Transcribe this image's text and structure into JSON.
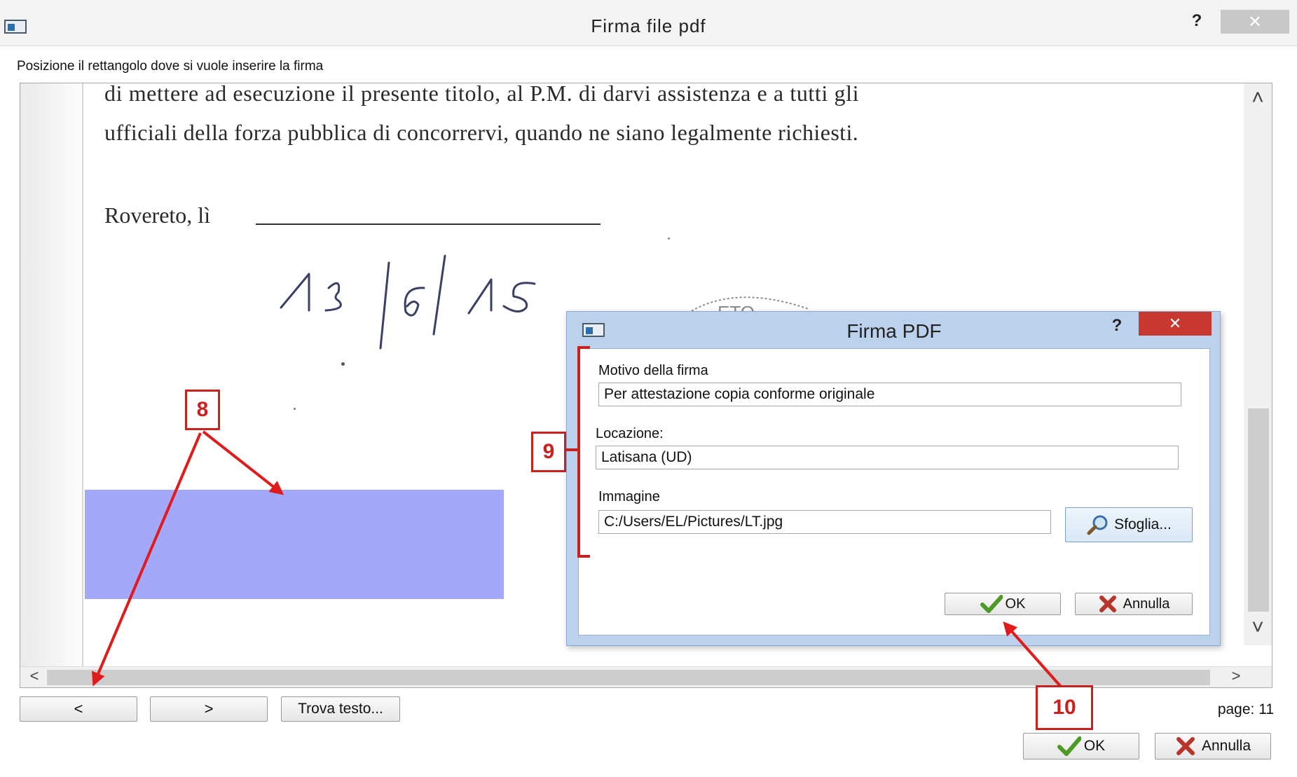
{
  "main_window": {
    "title": "Firma file pdf",
    "help_label": "?",
    "close_label": "✕",
    "instruction": "Posizione il rettangolo dove si vuole inserire la firma"
  },
  "document": {
    "line1": "di mettere ad esecuzione il presente titolo, al P.M. di darvi assistenza e a tutti gli",
    "line2": "ufficiali della forza pubblica di concorrervi, quando ne siano legalmente richiesti.",
    "place_label": "Rovereto, lì",
    "handwritten_date": "13/6/15",
    "stamp_fragment": "ETO"
  },
  "scroll": {
    "up": "˄",
    "down": "˅",
    "left": "<",
    "right": ">"
  },
  "nav": {
    "prev_label": "<",
    "next_label": ">",
    "find_label": "Trova testo...",
    "page_label": "page: 11"
  },
  "footer": {
    "ok_label": "OK",
    "cancel_label": "Annulla"
  },
  "dialog": {
    "title": "Firma PDF",
    "help_label": "?",
    "close_label": "✕",
    "reason_label": "Motivo della firma",
    "reason_value": "Per attestazione copia conforme originale",
    "location_label": "Locazione:",
    "location_value": "Latisana (UD)",
    "image_label": "Immagine",
    "image_value": "C:/Users/EL/Pictures/LT.jpg",
    "browse_label": "Sfoglia...",
    "ok_label": "OK",
    "cancel_label": "Annulla"
  },
  "callouts": {
    "c8": "8",
    "c9": "9",
    "c10": "10"
  },
  "colors": {
    "selection": "#a3a8fb",
    "callout": "#c9211e",
    "dialog_border": "#86a9d6",
    "close_button": "#c8382f"
  }
}
